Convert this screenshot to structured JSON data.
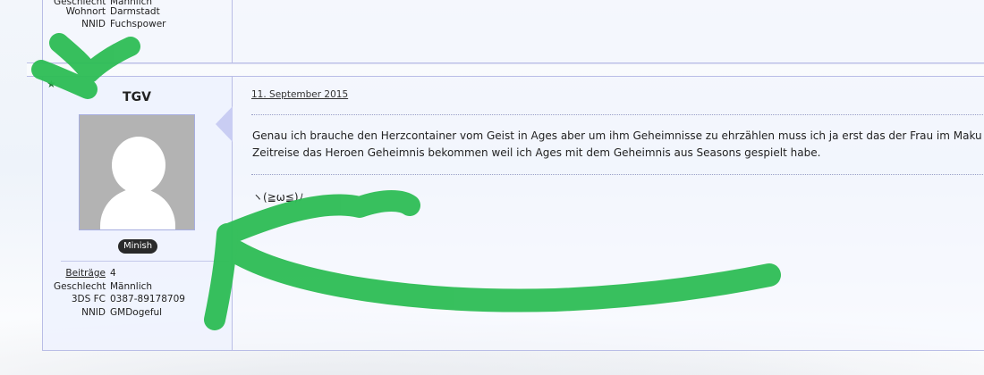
{
  "previous_post": {
    "gender_label": "Geschlecht",
    "gender_value": "Männlich",
    "location_label": "Wohnort",
    "location_value": "Darmstadt",
    "nnid_label": "NNID",
    "nnid_value": "Fuchspower"
  },
  "post": {
    "username": "TGV",
    "rank": "Minish",
    "date": "11. September 2015",
    "stats": {
      "posts_label": "Beiträge",
      "posts_value": "4",
      "gender_label": "Geschlecht",
      "gender_value": "Männlich",
      "ds_label": "3DS FC",
      "ds_value": "0387-89178709",
      "nnid_label": "NNID",
      "nnid_value": "GMDogeful"
    },
    "body_lines": [
      "Genau ich brauche den Herzcontainer vom Geist in Ages aber um ihm Geheimnisse zu ehrzählen muss ich ja erst das der Frau im Maku Baum",
      "Zeitreise das Heroen Geheimnis bekommen weil ich Ages mit dem Geheimnis aus Seasons gespielt habe."
    ],
    "signature": "ヽ(≧ω≦)ﾉ"
  },
  "icons": {
    "star": "star-icon"
  },
  "colors": {
    "frame_border": "#b9bde6",
    "marker_green": "#2dbd55",
    "badge_bg": "#2a2a2a"
  }
}
